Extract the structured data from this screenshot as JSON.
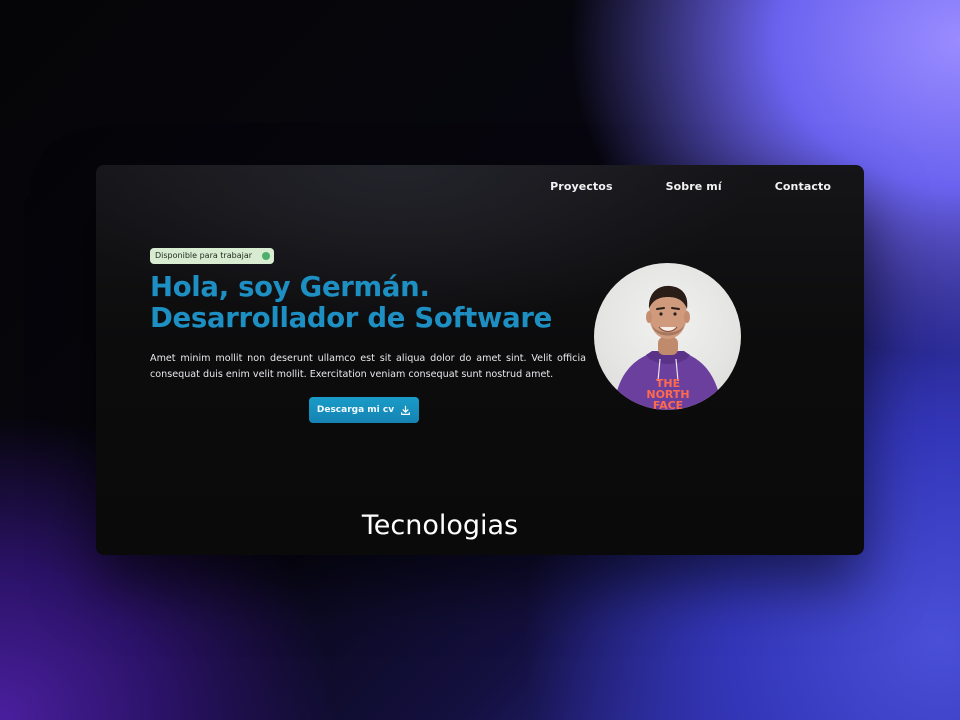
{
  "nav": {
    "items": [
      {
        "label": "Proyectos"
      },
      {
        "label": "Sobre mí"
      },
      {
        "label": "Contacto"
      }
    ]
  },
  "hero": {
    "badge": "Disponible para trabajar",
    "title_line1": "Hola, soy Germán.",
    "title_line2": "Desarrollador de Software",
    "description": "Amet minim mollit non deserunt ullamco est sit aliqua dolor do amet sint. Velit officia consequat duis enim velit mollit. Exercitation veniam consequat sunt nostrud amet.",
    "cta_label": "Descarga mi cv",
    "cta_icon": "download-icon",
    "avatar_shirt_text": "THE NORTH FACE"
  },
  "sections": {
    "technologies_title": "Tecnologias"
  },
  "colors": {
    "accent": "#1d8fc2",
    "badge_bg": "#d8ecd2",
    "badge_dot": "#4caf6a",
    "card_bg": "#0c0c0d"
  }
}
